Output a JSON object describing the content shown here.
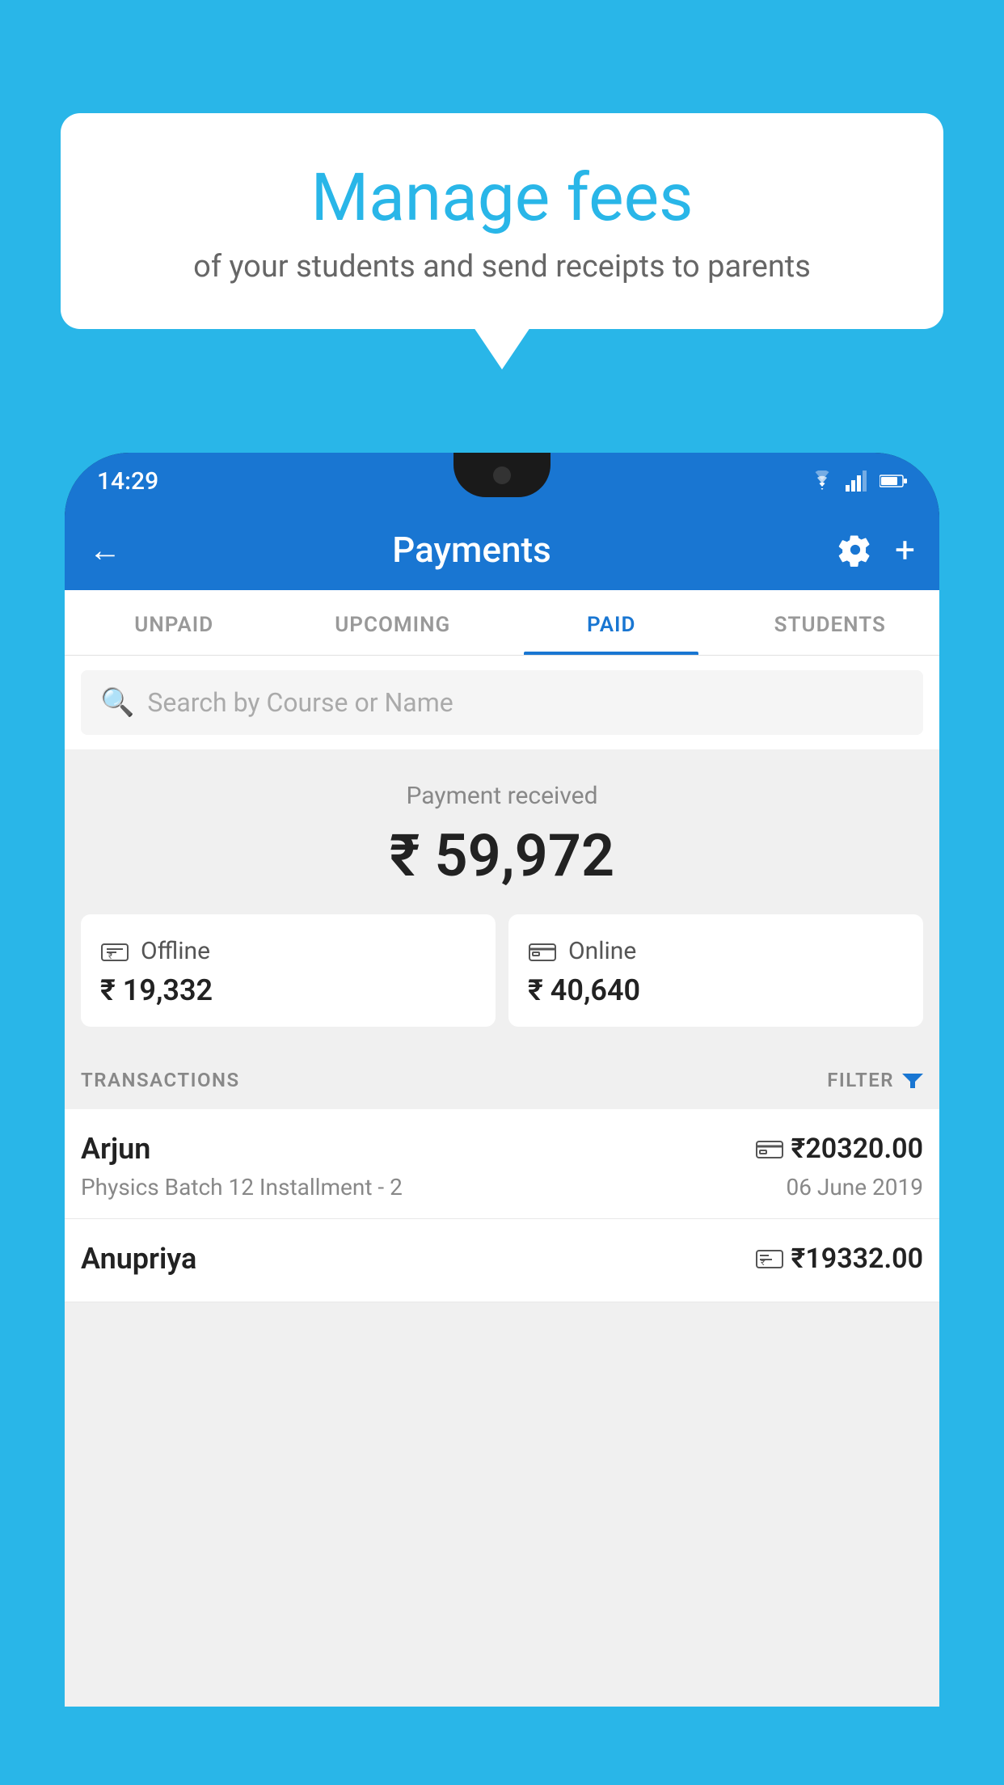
{
  "background_color": "#29B6E8",
  "speech_bubble": {
    "title": "Manage fees",
    "subtitle": "of your students and send receipts to parents"
  },
  "status_bar": {
    "time": "14:29",
    "wifi": "▼",
    "signal": "▲",
    "battery": "▮"
  },
  "header": {
    "title": "Payments",
    "back_label": "←",
    "settings_label": "⚙",
    "add_label": "+"
  },
  "tabs": [
    {
      "label": "UNPAID",
      "active": false
    },
    {
      "label": "UPCOMING",
      "active": false
    },
    {
      "label": "PAID",
      "active": true
    },
    {
      "label": "STUDENTS",
      "active": false
    }
  ],
  "search": {
    "placeholder": "Search by Course or Name"
  },
  "payment_summary": {
    "label": "Payment received",
    "amount": "₹ 59,972",
    "offline_label": "Offline",
    "offline_amount": "₹ 19,332",
    "online_label": "Online",
    "online_amount": "₹ 40,640"
  },
  "transactions_section": {
    "label": "TRANSACTIONS",
    "filter_label": "FILTER"
  },
  "transactions": [
    {
      "name": "Arjun",
      "amount": "₹20320.00",
      "detail": "Physics Batch 12 Installment - 2",
      "date": "06 June 2019",
      "type": "online"
    },
    {
      "name": "Anupriya",
      "amount": "₹19332.00",
      "detail": "",
      "date": "",
      "type": "offline"
    }
  ],
  "icons": {
    "search": "🔍",
    "back": "←",
    "gear": "⚙",
    "plus": "+",
    "filter": "▼",
    "online_card": "💳",
    "offline_card": "🪙"
  }
}
